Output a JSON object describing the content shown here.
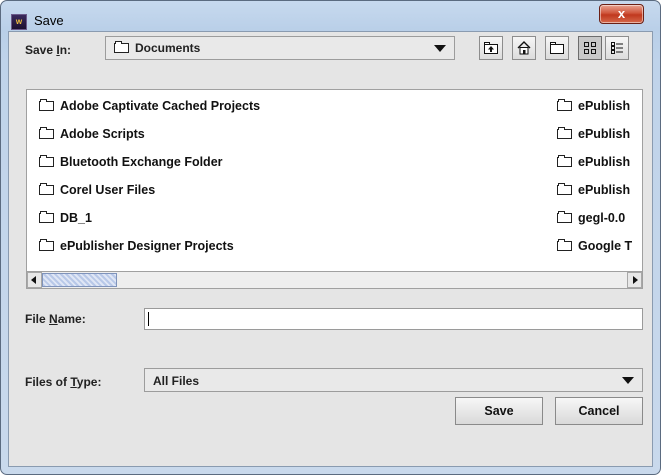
{
  "window": {
    "title": "Save",
    "app_icon_label": "w",
    "close_glyph": "x"
  },
  "save_in": {
    "label_prefix": "Save ",
    "label_mnemonic": "I",
    "label_suffix": "n:",
    "value": "Documents"
  },
  "toolbar": {
    "icons": [
      "up-one-level-icon",
      "home-icon",
      "new-folder-icon",
      "list-view-icon",
      "details-view-icon"
    ],
    "active": "list-view-icon"
  },
  "file_list": {
    "column1": [
      "Adobe Captivate Cached Projects",
      "Adobe Scripts",
      "Bluetooth Exchange Folder",
      "Corel User Files",
      "DB_1",
      "ePublisher Designer Projects"
    ],
    "column2": [
      "ePublish",
      "ePublish",
      "ePublish",
      "ePublish",
      "gegl-0.0",
      "Google T"
    ]
  },
  "file_name": {
    "label_prefix": "File ",
    "label_mnemonic": "N",
    "label_suffix": "ame:",
    "value": ""
  },
  "files_of_type": {
    "label_prefix": "Files of ",
    "label_mnemonic": "T",
    "label_suffix": "ype:",
    "value": "All Files"
  },
  "buttons": {
    "save": "Save",
    "cancel": "Cancel"
  }
}
